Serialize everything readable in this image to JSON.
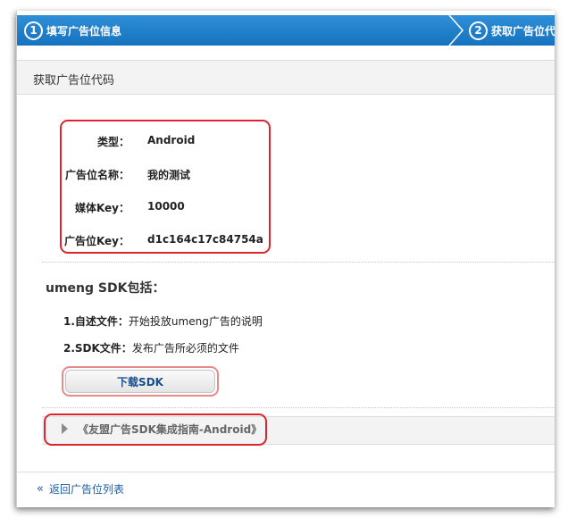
{
  "steps": [
    {
      "number": "1",
      "label": "填写广告位信息"
    },
    {
      "number": "2",
      "label": "获取广告位代"
    }
  ],
  "section": {
    "title": "获取广告位代码"
  },
  "info": {
    "type_label": "类型：",
    "type_value": "Android",
    "name_label": "广告位名称：",
    "name_value": "我的测试",
    "media_key_label": "媒体Key：",
    "media_key_value": "10000",
    "slot_key_label": "广告位Key：",
    "slot_key_value": "d1c164c17c84754a"
  },
  "sdk": {
    "title": "umeng SDK包括：",
    "items": [
      {
        "name": "1.自述文件：",
        "desc": "开始投放umeng广告的说明"
      },
      {
        "name": "2.SDK文件：",
        "desc": "发布广告所必须的文件"
      }
    ],
    "download_label": "下载SDK"
  },
  "guide": {
    "label": "《友盟广告SDK集成指南-Android》"
  },
  "back": {
    "icon": "double-chevron-left-icon",
    "label": "返回广告位列表"
  },
  "colors": {
    "accent_blue": "#1a78c6",
    "highlight_red": "#d9262e",
    "link": "#1a5ea8"
  }
}
